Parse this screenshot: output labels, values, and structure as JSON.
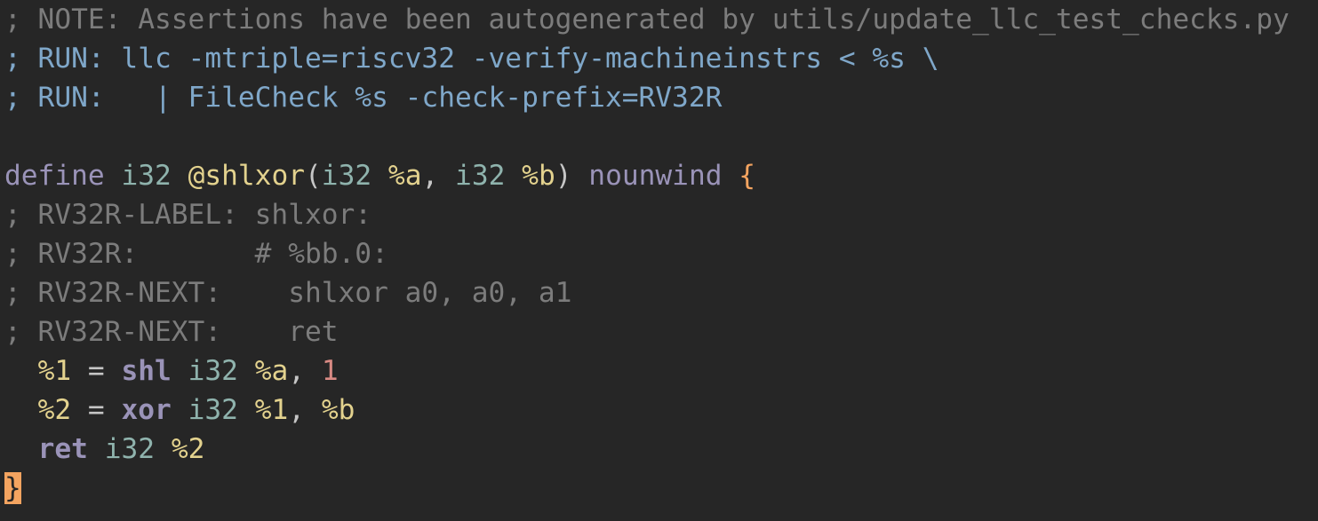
{
  "editor": {
    "lines": [
      [
        {
          "t": "; NOTE: Assertions have been autogenerated by utils/update_llc_test_checks.py",
          "c": "comment"
        }
      ],
      [
        {
          "t": "; RUN: llc -mtriple=riscv32 -verify-machineinstrs < %s \\",
          "c": "run"
        }
      ],
      [
        {
          "t": "; RUN:   | FileCheck %s -check-prefix=RV32R",
          "c": "run"
        }
      ],
      [
        {
          "t": "",
          "c": "punct"
        }
      ],
      [
        {
          "t": "define",
          "c": "keyword"
        },
        {
          "t": " ",
          "c": "punct"
        },
        {
          "t": "i32",
          "c": "type"
        },
        {
          "t": " ",
          "c": "punct"
        },
        {
          "t": "@shlxor",
          "c": "func"
        },
        {
          "t": "(",
          "c": "punct"
        },
        {
          "t": "i32",
          "c": "type"
        },
        {
          "t": " ",
          "c": "punct"
        },
        {
          "t": "%a",
          "c": "var"
        },
        {
          "t": ", ",
          "c": "punct"
        },
        {
          "t": "i32",
          "c": "type"
        },
        {
          "t": " ",
          "c": "punct"
        },
        {
          "t": "%b",
          "c": "var"
        },
        {
          "t": ") ",
          "c": "punct"
        },
        {
          "t": "nounwind",
          "c": "keyword"
        },
        {
          "t": " ",
          "c": "punct"
        },
        {
          "t": "{",
          "c": "brace"
        }
      ],
      [
        {
          "t": "; RV32R-LABEL: shlxor:",
          "c": "comment"
        }
      ],
      [
        {
          "t": "; RV32R:       # %bb.0:",
          "c": "comment"
        }
      ],
      [
        {
          "t": "; RV32R-NEXT:    shlxor a0, a0, a1",
          "c": "comment"
        }
      ],
      [
        {
          "t": "; RV32R-NEXT:    ret",
          "c": "comment"
        }
      ],
      [
        {
          "t": "  ",
          "c": "punct"
        },
        {
          "t": "%1",
          "c": "var"
        },
        {
          "t": " = ",
          "c": "punct"
        },
        {
          "t": "shl",
          "c": "op"
        },
        {
          "t": " ",
          "c": "punct"
        },
        {
          "t": "i32",
          "c": "type"
        },
        {
          "t": " ",
          "c": "punct"
        },
        {
          "t": "%a",
          "c": "var"
        },
        {
          "t": ", ",
          "c": "punct"
        },
        {
          "t": "1",
          "c": "num"
        }
      ],
      [
        {
          "t": "  ",
          "c": "punct"
        },
        {
          "t": "%2",
          "c": "var"
        },
        {
          "t": " = ",
          "c": "punct"
        },
        {
          "t": "xor",
          "c": "op"
        },
        {
          "t": " ",
          "c": "punct"
        },
        {
          "t": "i32",
          "c": "type"
        },
        {
          "t": " ",
          "c": "punct"
        },
        {
          "t": "%1",
          "c": "var"
        },
        {
          "t": ", ",
          "c": "punct"
        },
        {
          "t": "%b",
          "c": "var"
        }
      ],
      [
        {
          "t": "  ",
          "c": "punct"
        },
        {
          "t": "ret",
          "c": "op"
        },
        {
          "t": " ",
          "c": "punct"
        },
        {
          "t": "i32",
          "c": "type"
        },
        {
          "t": " ",
          "c": "punct"
        },
        {
          "t": "%2",
          "c": "var"
        }
      ],
      [
        {
          "t": "}",
          "c": "brace cursor"
        }
      ]
    ]
  }
}
